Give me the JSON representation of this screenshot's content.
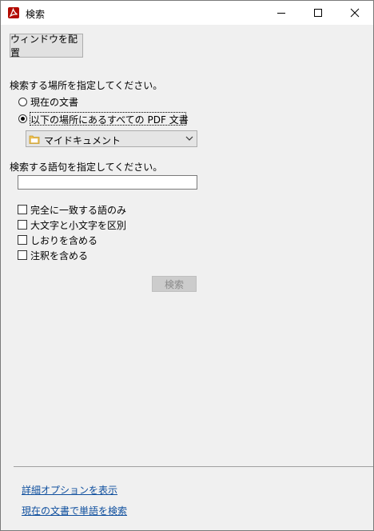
{
  "window": {
    "title": "検索",
    "icon": "acrobat-icon",
    "controls": [
      "minimize-icon",
      "maximize-icon",
      "close-icon"
    ]
  },
  "toolbar": {
    "arrange_label": "ウィンドウを配置"
  },
  "location": {
    "heading": "検索する場所を指定してください。",
    "option_current": "現在の文書",
    "option_all": "以下の場所にあるすべての PDF 文書",
    "selected": "option_all",
    "dropdown_value": "マイドキュメント"
  },
  "query": {
    "heading": "検索する語句を指定してください。",
    "value": ""
  },
  "options": {
    "whole_words": "完全に一致する語のみ",
    "case_sensitive": "大文字と小文字を区別",
    "bookmarks": "しおりを含める",
    "comments": "注釈を含める"
  },
  "search_button": "検索",
  "links": {
    "advanced": "詳細オプションを表示",
    "find_in_document": "現在の文書で単語を検索"
  },
  "colors": {
    "link": "#0f4f9e",
    "acrobat_red": "#b30b00",
    "disabled_text": "#8a8a8a"
  }
}
